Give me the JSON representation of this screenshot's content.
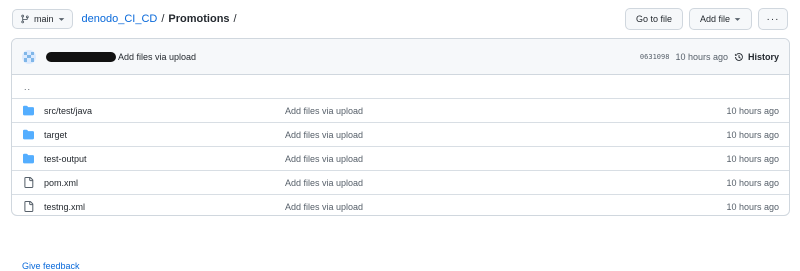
{
  "branch": {
    "label": "main"
  },
  "breadcrumb": {
    "repo": "denodo_CI_CD",
    "sep1": "/",
    "folder": "Promotions",
    "sep2": "/"
  },
  "actions": {
    "go_to_file": "Go to file",
    "add_file": "Add file",
    "more": "···"
  },
  "commit": {
    "message": "Add files via upload",
    "sha": "0631098",
    "time": "10 hours ago",
    "history": "History"
  },
  "parent_dir": "..",
  "files": [
    {
      "type": "folder",
      "icon": "folder-icon",
      "name": "src/test/java",
      "message": "Add files via upload",
      "time": "10 hours ago"
    },
    {
      "type": "folder",
      "icon": "folder-icon",
      "name": "target",
      "message": "Add files via upload",
      "time": "10 hours ago"
    },
    {
      "type": "folder",
      "icon": "folder-icon",
      "name": "test-output",
      "message": "Add files via upload",
      "time": "10 hours ago"
    },
    {
      "type": "file",
      "icon": "file-icon",
      "name": "pom.xml",
      "message": "Add files via upload",
      "time": "10 hours ago"
    },
    {
      "type": "file",
      "icon": "file-icon",
      "name": "testng.xml",
      "message": "Add files via upload",
      "time": "10 hours ago"
    }
  ],
  "footer": {
    "feedback": "Give feedback"
  },
  "colors": {
    "link": "#0969da",
    "folder": "#54aeff",
    "border": "#d0d7de",
    "muted": "#57606a"
  }
}
